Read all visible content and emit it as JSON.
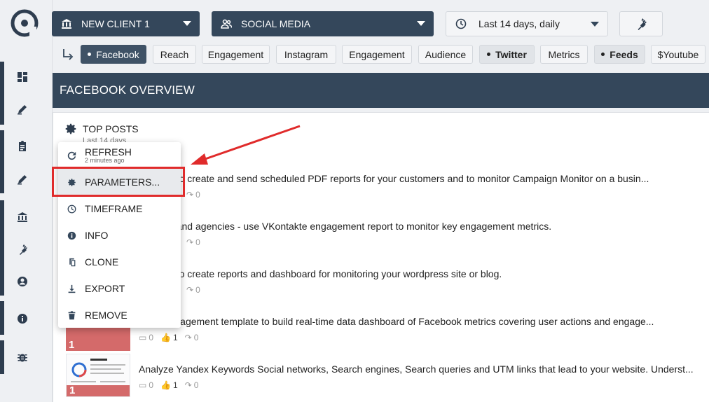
{
  "top_bar": {
    "client_select": "NEW CLIENT 1",
    "category_select": "SOCIAL MEDIA",
    "period_select": "Last 14 days, daily"
  },
  "tabs": [
    {
      "label": "Facebook",
      "state": "active"
    },
    {
      "label": "Reach",
      "state": "normal"
    },
    {
      "label": "Engagement",
      "state": "normal"
    },
    {
      "label": "Instagram",
      "state": "normal"
    },
    {
      "label": "Engagement",
      "state": "normal"
    },
    {
      "label": "Audience",
      "state": "normal"
    },
    {
      "label": "Twitter",
      "state": "bold"
    },
    {
      "label": "Metrics",
      "state": "normal"
    },
    {
      "label": "Feeds",
      "state": "bold"
    },
    {
      "label": "$Youtube",
      "state": "normal"
    }
  ],
  "overview_title": "FACEBOOK OVERVIEW",
  "card": {
    "title": "TOP POSTS",
    "subtitle": "Last 14 days"
  },
  "posts": [
    {
      "text": "emplate to create and send scheduled PDF reports for your customers and to monitor Campaign Monitor on a busin...",
      "shares": "0"
    },
    {
      "text": "g teams and agencies - use VKontakte engagement report to monitor key engagement metrics.",
      "shares": "0"
    },
    {
      "text": "emplate to create reports and dashboard for monitoring your wordpress site or blog.",
      "shares": "0"
    },
    {
      "text": "book Engagement template to build real-time data dashboard of Facebook metrics covering user actions and engage...",
      "comments": "0",
      "likes": "1",
      "shares": "0",
      "rank": "1"
    },
    {
      "text": "Analyze Yandex Keywords Social networks, Search engines, Search queries and UTM links that lead to your website. Underst...",
      "comments": "0",
      "likes": "1",
      "shares": "0",
      "rank": "1"
    }
  ],
  "menu": {
    "refresh": "REFRESH",
    "refresh_time": "2 minutes ago",
    "parameters": "PARAMETERS...",
    "timeframe": "TIMEFRAME",
    "info": "INFO",
    "clone": "CLONE",
    "export": "EXPORT",
    "remove": "REMOVE"
  },
  "colors": {
    "navy": "#34475b",
    "annotation_red": "#e02b2b",
    "thumb_red": "#d46a6a"
  }
}
